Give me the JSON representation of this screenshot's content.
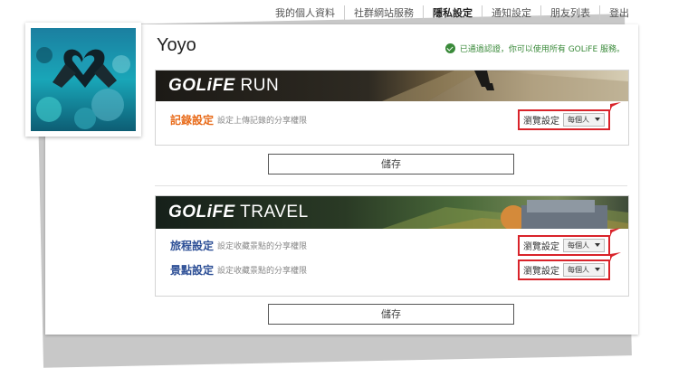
{
  "nav": {
    "items": [
      "我的個人資料",
      "社群網站服務",
      "隱私設定",
      "通知設定",
      "朋友列表",
      "登出"
    ],
    "active_index": 2
  },
  "profile": {
    "username": "Yoyo",
    "verified_text": "已通過認證，你可以使用所有 GOLiFE 服務。"
  },
  "run_section": {
    "brand": "GOLiFE",
    "product": "RUN",
    "rows": [
      {
        "title": "記錄設定",
        "desc": "設定上傳記錄的分享權限",
        "control_label": "瀏覽設定",
        "value": "每個人"
      }
    ]
  },
  "travel_section": {
    "brand": "GOLiFE",
    "product": "TRAVEL",
    "rows": [
      {
        "title": "旅程設定",
        "desc": "設定收藏景點的分享權限",
        "control_label": "瀏覽設定",
        "value": "每個人"
      },
      {
        "title": "景點設定",
        "desc": "設定收藏景點的分享權限",
        "control_label": "瀏覽設定",
        "value": "每個人"
      }
    ]
  },
  "buttons": {
    "save_label_1": "儲存",
    "save_label_2": "儲存"
  },
  "colors": {
    "accent_red": "#d9232a",
    "run_title": "#e86b1a",
    "travel_title": "#2d4f96",
    "verified_green": "#3a8a3a"
  }
}
